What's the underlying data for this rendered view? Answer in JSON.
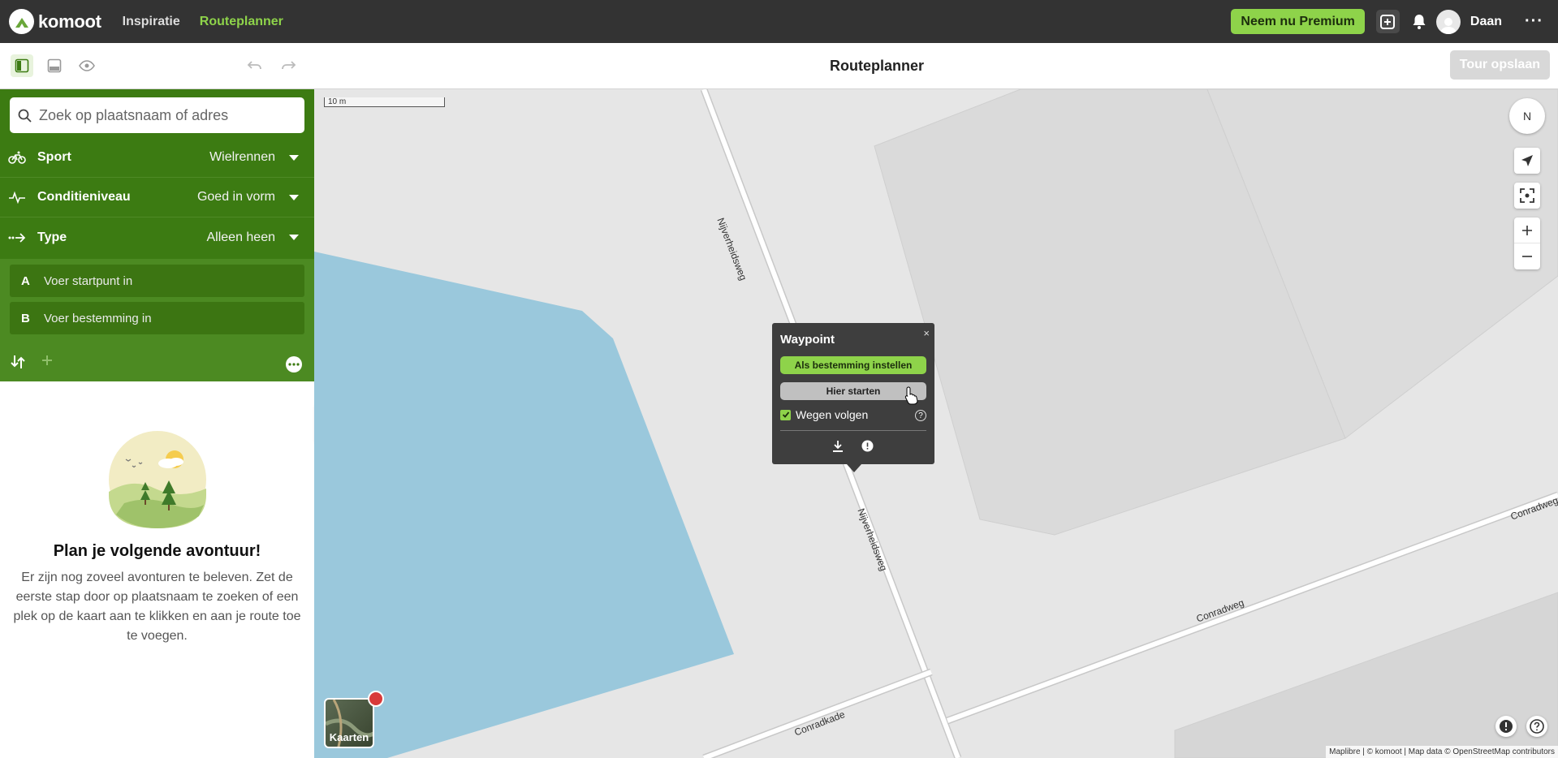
{
  "header": {
    "brand": "komoot",
    "nav": [
      {
        "label": "Inspiratie"
      },
      {
        "label": "Routeplanner"
      }
    ],
    "premium_label": "Neem nu Premium",
    "user_name": "Daan",
    "more": "···"
  },
  "toolbar": {
    "title": "Routeplanner",
    "save_label": "Tour opslaan"
  },
  "planner": {
    "search_placeholder": "Zoek op plaatsnaam of adres",
    "options": [
      {
        "label": "Sport",
        "value": "Wielrennen",
        "icon": "bike-icon"
      },
      {
        "label": "Conditieniveau",
        "value": "Goed in vorm",
        "icon": "pulse-icon"
      },
      {
        "label": "Type",
        "value": "Alleen heen",
        "icon": "one-way-icon"
      }
    ],
    "waypoints": [
      {
        "letter": "A",
        "placeholder": "Voer startpunt in"
      },
      {
        "letter": "B",
        "placeholder": "Voer bestemming in"
      }
    ]
  },
  "empty_state": {
    "title": "Plan je volgende avontuur!",
    "text": "Er zijn nog zoveel avonturen te beleven. Zet de eerste stap door op plaatsnaam te zoeken of een plek op de kaart aan te klikken en aan je route toe te voegen."
  },
  "map": {
    "scale_label": "10 m",
    "compass_label": "N",
    "street_labels": [
      "Nijverheidsweg",
      "Nijverheidsweg",
      "Conradweg",
      "Conradweg",
      "Conradkade"
    ],
    "map_card_label": "Kaarten",
    "attribution": "Maplibre | © komoot | Map data © OpenStreetMap contributors",
    "popup": {
      "title": "Waypoint",
      "close": "×",
      "set_destination": "Als bestemming instellen",
      "start_here": "Hier starten",
      "follow_roads": "Wegen volgen",
      "follow_roads_checked": true
    }
  },
  "colors": {
    "topbar": "#333333",
    "accent": "#8ed34a",
    "planner_green": "#3c7b12",
    "water": "#9ac8dc"
  }
}
